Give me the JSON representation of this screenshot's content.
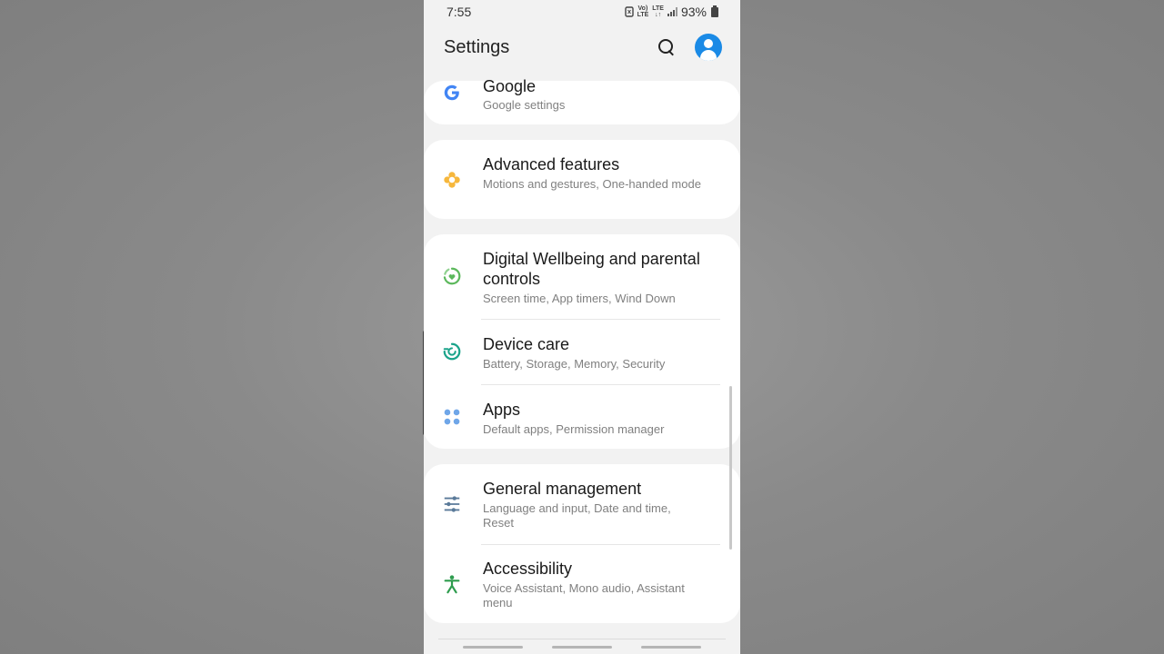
{
  "status_bar": {
    "time": "7:55",
    "volte_top": "Vo)",
    "volte_bottom": "LTE",
    "lte_top": "LTE",
    "lte_bottom": "↓↑",
    "battery_percent": "93%"
  },
  "app_bar": {
    "title": "Settings",
    "search_icon": "search-icon",
    "account_icon": "account-avatar-icon"
  },
  "settings": {
    "google": {
      "title": "Google",
      "subtitle": "Google settings",
      "icon": "google-icon",
      "color": "#4285f4"
    },
    "advanced_features": {
      "title": "Advanced features",
      "subtitle": "Motions and gestures, One-handed mode",
      "icon": "puzzle-flower-icon",
      "color": "#f6b73c"
    },
    "digital_wellbeing": {
      "title": "Digital Wellbeing and parental controls",
      "subtitle": "Screen time, App timers, Wind Down",
      "icon": "wellbeing-heart-icon",
      "color": "#5cb85c"
    },
    "device_care": {
      "title": "Device care",
      "subtitle": "Battery, Storage, Memory, Security",
      "icon": "device-care-icon",
      "color": "#1aa38a"
    },
    "apps": {
      "title": "Apps",
      "subtitle": "Default apps, Permission manager",
      "icon": "apps-dots-icon",
      "color": "#6fa6e8"
    },
    "general_management": {
      "title": "General management",
      "subtitle": "Language and input, Date and time, Reset",
      "icon": "sliders-icon",
      "color": "#5a7a99"
    },
    "accessibility": {
      "title": "Accessibility",
      "subtitle": "Voice Assistant, Mono audio, Assistant menu",
      "icon": "accessibility-person-icon",
      "color": "#2e9c4e"
    }
  }
}
